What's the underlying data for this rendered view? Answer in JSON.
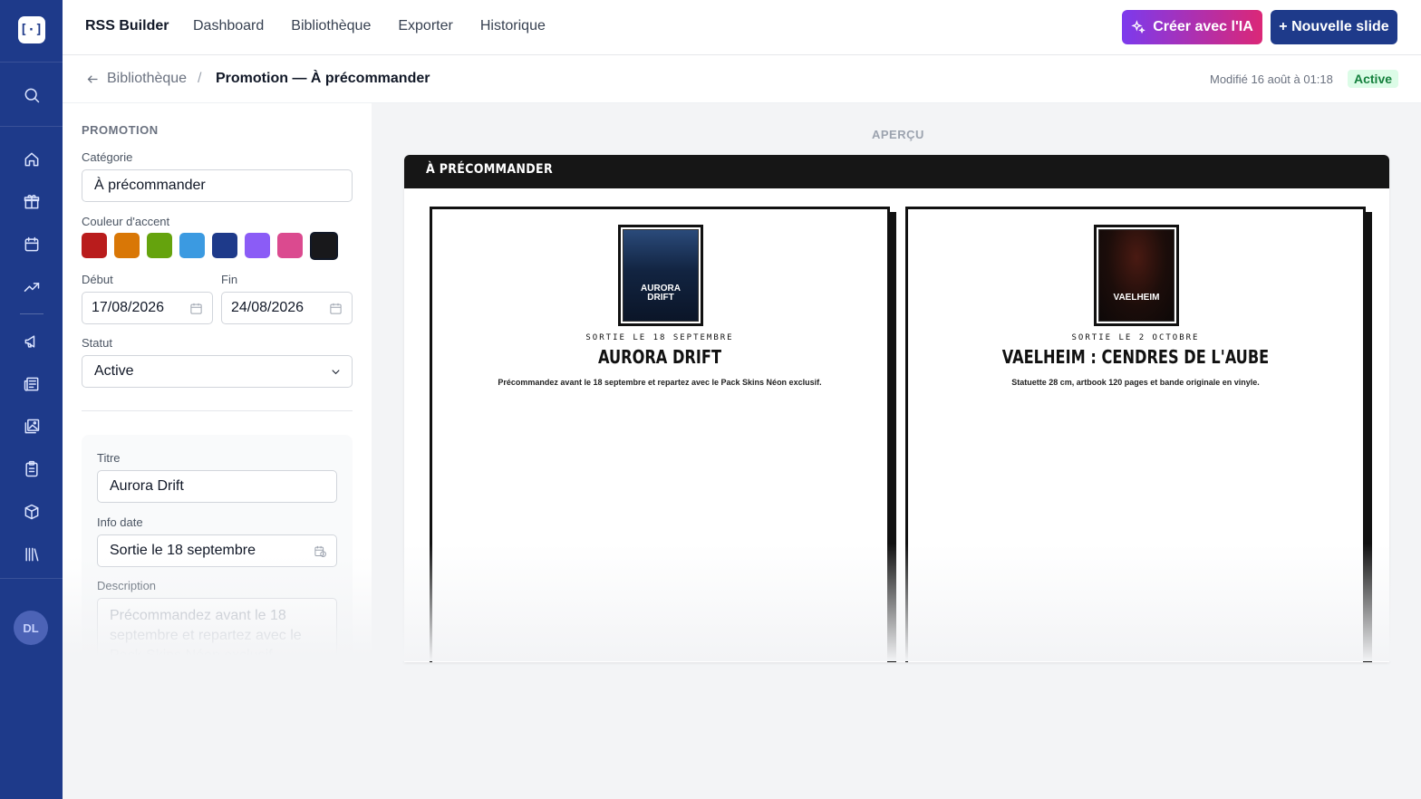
{
  "app": {
    "title": "RSS Builder",
    "logo": "[·]",
    "avatar_initials": "DL"
  },
  "nav": {
    "items": [
      "Dashboard",
      "Bibliothèque",
      "Exporter",
      "Historique"
    ]
  },
  "actions": {
    "ai_label": "Créer avec l'IA",
    "new_slide_label": "+ Nouvelle slide"
  },
  "breadcrumb": {
    "back_label": "Bibliothèque",
    "separator": "/",
    "current": "Promotion — À précommander"
  },
  "meta": {
    "modified": "Modifié 16 août à 01:18",
    "status_badge": "Active"
  },
  "form": {
    "section_title": "PROMOTION",
    "category_label": "Catégorie",
    "category_value": "À précommander",
    "accent_label": "Couleur d'accent",
    "accent_colors": [
      "#b91c1c",
      "#d97706",
      "#65a30d",
      "#3b9ae1",
      "#1e3a8a",
      "#8b5cf6",
      "#db4a8f",
      "#18181b"
    ],
    "start_label": "Début",
    "start_value": "17/08/2026",
    "end_label": "Fin",
    "end_value": "24/08/2026",
    "status_label": "Statut",
    "status_value": "Active",
    "item": {
      "title_label": "Titre",
      "title_value": "Aurora Drift",
      "date_label": "Info date",
      "date_value": "Sortie le 18 septembre",
      "description_label": "Description",
      "description_value": "Précommandez avant le 18 septembre et repartez avec le Pack Skins Néon exclusif."
    }
  },
  "preview": {
    "label": "APERÇU",
    "header": "À PRÉCOMMANDER",
    "cards": [
      {
        "cover_text": "AURORA DRIFT",
        "date": "SORTIE LE 18 SEPTEMBRE",
        "title": "AURORA DRIFT",
        "description": "Précommandez avant le 18 septembre et repartez avec le Pack Skins Néon exclusif."
      },
      {
        "cover_text": "VAELHEIM",
        "date": "SORTIE LE 2 OCTOBRE",
        "title": "VAELHEIM : CENDRES DE L'AUBE",
        "description": "Statuette 28 cm, artbook 120 pages et bande originale en vinyle."
      }
    ]
  }
}
